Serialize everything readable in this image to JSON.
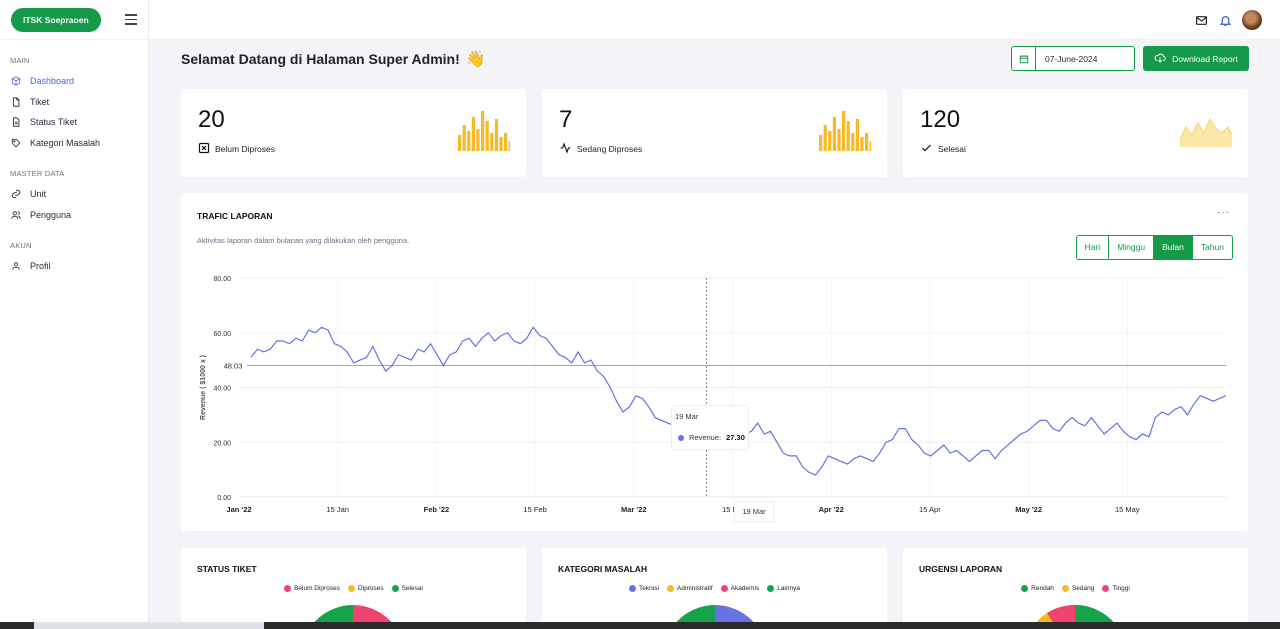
{
  "brand": "ITSK Soepraoen",
  "sidebar": {
    "sections": [
      {
        "title": "MAIN",
        "items": [
          {
            "label": "Dashboard",
            "icon": "cube-icon",
            "active": true
          },
          {
            "label": "Tiket",
            "icon": "file-icon"
          },
          {
            "label": "Status Tiket",
            "icon": "file-text-icon"
          },
          {
            "label": "Kategori Masalah",
            "icon": "tag-icon"
          }
        ]
      },
      {
        "title": "MASTER DATA",
        "items": [
          {
            "label": "Unit",
            "icon": "link-icon"
          },
          {
            "label": "Pengguna",
            "icon": "users-icon"
          }
        ]
      },
      {
        "title": "AKUN",
        "items": [
          {
            "label": "Profil",
            "icon": "user-icon"
          }
        ]
      }
    ]
  },
  "header": {
    "welcome": "Selamat Datang di Halaman Super Admin!",
    "wave": "👋",
    "date": "07-June-2024",
    "download_label": "Download Report"
  },
  "stats": [
    {
      "value": "20",
      "label": "Belum Diproses",
      "icon": "x-square-icon"
    },
    {
      "value": "7",
      "label": "Sedang Diproses",
      "icon": "activity-icon"
    },
    {
      "value": "120",
      "label": "Selesai",
      "icon": "check-icon"
    }
  ],
  "traffic": {
    "title": "TRAFIC LAPORAN",
    "subtitle": "Aktivitas laporan dalam bulanan yang dilakukan oleh pengguna.",
    "ranges": [
      "Hari",
      "Minggu",
      "Bulan",
      "Tahun"
    ],
    "active_range": "Bulan",
    "more": "···",
    "tooltip": {
      "title": "19 Mar",
      "series": "Revenue:",
      "value": "27.30"
    },
    "x_tooltip": "19 Mar"
  },
  "chart_data": {
    "type": "line",
    "ylabel": "Revenue ( $1000 x )",
    "ylim": [
      0,
      80
    ],
    "yticks": [
      "0.00",
      "20.00",
      "40.00",
      "60.00",
      "80.00"
    ],
    "xticks": [
      "Jan '22",
      "15 Jan",
      "Feb '22",
      "15 Feb",
      "Mar '22",
      "15 Ma",
      "Apr '22",
      "15 Apr",
      "May '22",
      "15 May"
    ],
    "annotation": {
      "y": 48.03,
      "label": "48.03"
    },
    "series": [
      {
        "name": "Revenue",
        "color": "#6772e5",
        "values": [
          51,
          54,
          53,
          54,
          57,
          57,
          56,
          58,
          57,
          61,
          60,
          62,
          61,
          56,
          55,
          53,
          49,
          50,
          51,
          55,
          50,
          46,
          48,
          52,
          51,
          50,
          54,
          53,
          56,
          52,
          48,
          52,
          53,
          57,
          58,
          55,
          58,
          60,
          57,
          59,
          60,
          57,
          56,
          58,
          62,
          59,
          58,
          55,
          52,
          51,
          49,
          53,
          49,
          50,
          46,
          44,
          40,
          35,
          31,
          33,
          37,
          36,
          33,
          29,
          28,
          27,
          26,
          27,
          28,
          26,
          25,
          27.3,
          30,
          28,
          30,
          27,
          24,
          23,
          24,
          27,
          23,
          24,
          20,
          16,
          15,
          15,
          11,
          9,
          8,
          11,
          15,
          14,
          13,
          12,
          14,
          15,
          14,
          13,
          16,
          20,
          21,
          25,
          25,
          21,
          19,
          16,
          15,
          17,
          19,
          16,
          17,
          15,
          13,
          15,
          17,
          17,
          14,
          17,
          19,
          21,
          23,
          24,
          26,
          28,
          28,
          25,
          24,
          27,
          29,
          27,
          26,
          29,
          26,
          23,
          25,
          27,
          24,
          22,
          21,
          23,
          22,
          29,
          31,
          30,
          32,
          33,
          30,
          34,
          37,
          36,
          35,
          36,
          37
        ]
      }
    ]
  },
  "bottom_cards": [
    {
      "title": "STATUS TIKET",
      "legend": [
        {
          "label": "Belum Diproses",
          "color": "#f0446f"
        },
        {
          "label": "Diproses",
          "color": "#f7b924"
        },
        {
          "label": "Selesai",
          "color": "#16a34a"
        }
      ]
    },
    {
      "title": "KATEGORI MASALAH",
      "legend": [
        {
          "label": "Teknisi",
          "color": "#6772e5"
        },
        {
          "label": "Administratif",
          "color": "#f7b924"
        },
        {
          "label": "Akademis",
          "color": "#f0446f"
        },
        {
          "label": "Lainnya",
          "color": "#16a34a"
        }
      ]
    },
    {
      "title": "URGENSI LAPORAN",
      "legend": [
        {
          "label": "Rendah",
          "color": "#16a34a"
        },
        {
          "label": "Sedang",
          "color": "#f7b924"
        },
        {
          "label": "Tinggi",
          "color": "#f0446f"
        }
      ]
    }
  ]
}
